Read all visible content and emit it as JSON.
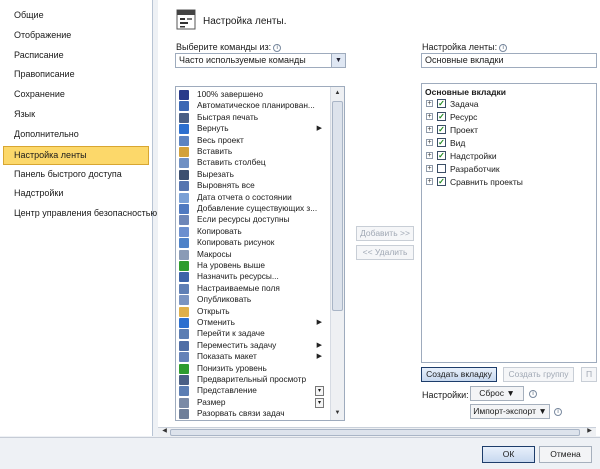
{
  "nav": {
    "items": [
      "Общие",
      "Отображение",
      "Расписание",
      "Правописание",
      "Сохранение",
      "Язык",
      "Дополнительно",
      "Настройка ленты",
      "Панель быстрого доступа",
      "Надстройки",
      "Центр управления безопасностью"
    ],
    "selected": "Настройка ленты"
  },
  "header": {
    "title": "Настройка ленты."
  },
  "left": {
    "label": "Выберите команды из:",
    "combo_value": "Часто используемые команды",
    "commands": [
      {
        "label": "100% завершено",
        "icon": "percent-complete-icon",
        "color": "#2a3a8a"
      },
      {
        "label": "Автоматическое планирован...",
        "icon": "auto-schedule-icon",
        "color": "#3b67b4"
      },
      {
        "label": "Быстрая печать",
        "icon": "printer-icon",
        "color": "#4a5f85"
      },
      {
        "label": "Вернуть",
        "icon": "redo-icon",
        "color": "#2c6fcf",
        "submenu": true
      },
      {
        "label": "Весь проект",
        "icon": "whole-project-icon",
        "color": "#5b83c2"
      },
      {
        "label": "Вставить",
        "icon": "paste-icon",
        "color": "#d3a13a"
      },
      {
        "label": "Вставить столбец",
        "icon": "insert-column-icon",
        "color": "#6f90c4"
      },
      {
        "label": "Вырезать",
        "icon": "scissors-icon",
        "color": "#3c4f70"
      },
      {
        "label": "Выровнять все",
        "icon": "level-all-icon",
        "color": "#5675b0"
      },
      {
        "label": "Дата отчета о состоянии",
        "icon": "status-date-icon",
        "color": "#7aa0d6"
      },
      {
        "label": "Добавление существующих з...",
        "icon": "add-task-icon",
        "color": "#4f79c0"
      },
      {
        "label": "Если ресурсы доступны",
        "icon": "resources-available-icon",
        "color": "#6d86b8"
      },
      {
        "label": "Копировать",
        "icon": "copy-icon",
        "color": "#6b8fcf"
      },
      {
        "label": "Копировать рисунок",
        "icon": "copy-picture-icon",
        "color": "#4e82c8"
      },
      {
        "label": "Макросы",
        "icon": "macros-icon",
        "color": "#8a9bb6"
      },
      {
        "label": "На уровень выше",
        "icon": "green-arrow-left-icon",
        "color": "#2e9c2e"
      },
      {
        "label": "Назначить ресурсы...",
        "icon": "assign-resources-icon",
        "color": "#3c63a8"
      },
      {
        "label": "Настраиваемые поля",
        "icon": "custom-fields-icon",
        "color": "#5f7fb5"
      },
      {
        "label": "Опубликовать",
        "icon": "publish-icon",
        "color": "#7a94c2"
      },
      {
        "label": "Открыть",
        "icon": "open-folder-icon",
        "color": "#e0b04a"
      },
      {
        "label": "Отменить",
        "icon": "undo-icon",
        "color": "#2c6fcf",
        "submenu": true
      },
      {
        "label": "Перейти к задаче",
        "icon": "goto-task-icon",
        "color": "#5b7db3"
      },
      {
        "label": "Переместить задачу",
        "icon": "move-task-icon",
        "color": "#4f6ea6",
        "submenu": true
      },
      {
        "label": "Показать макет",
        "icon": "show-layout-icon",
        "color": "#6582b8",
        "submenu": true
      },
      {
        "label": "Понизить уровень",
        "icon": "green-arrow-right-icon",
        "color": "#2e9c2e"
      },
      {
        "label": "Предварительный просмотр",
        "icon": "print-preview-icon",
        "color": "#4a5f85"
      },
      {
        "label": "Представление",
        "icon": "view-icon",
        "color": "#5b7db3",
        "toggle": true
      },
      {
        "label": "Размер",
        "icon": "size-icon",
        "color": "#7a8aa6",
        "toggle": true
      },
      {
        "label": "Разорвать связи задач",
        "icon": "unlink-tasks-icon",
        "color": "#6f7f9a"
      }
    ]
  },
  "middle": {
    "add_label": "Добавить >>",
    "remove_label": "<< Удалить"
  },
  "right": {
    "label": "Настройка ленты:",
    "combo_value": "Основные вкладки",
    "tree_header": "Основные вкладки",
    "tabs": [
      {
        "label": "Задача",
        "checked": true
      },
      {
        "label": "Ресурс",
        "checked": true
      },
      {
        "label": "Проект",
        "checked": true
      },
      {
        "label": "Вид",
        "checked": true
      },
      {
        "label": "Надстройки",
        "checked": true
      },
      {
        "label": "Разработчик",
        "checked": false
      },
      {
        "label": "Сравнить проекты",
        "checked": true
      }
    ],
    "new_tab_label": "Создать вкладку",
    "new_group_label": "Создать группу",
    "rename_label": "П",
    "settings_label": "Настройки:",
    "reset_label": "Сброс ▼",
    "import_export_label": "Импорт-экспорт ▼"
  },
  "footer": {
    "ok_label": "ОК",
    "cancel_label": "Отмена"
  },
  "colors": {
    "selection": "#fcd86a",
    "selection_border": "#d8a631",
    "check": "#1d8a1d"
  }
}
